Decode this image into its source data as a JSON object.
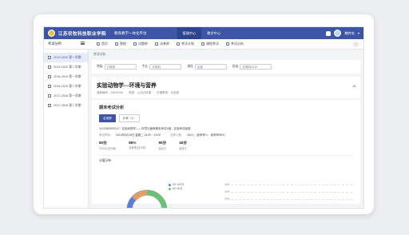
{
  "header": {
    "school_name": "江苏农牧科技职业学院",
    "platform_name": "教育教学一体化平台",
    "nav": [
      {
        "label": "管理中心",
        "active": true
      },
      {
        "label": "教学中心",
        "active": false
      }
    ],
    "user_name": "魏传东"
  },
  "secondary": {
    "section_title": "考试分析",
    "items": [
      {
        "label": "首页",
        "icon": "home-icon"
      },
      {
        "label": "院校",
        "icon": "school-icon"
      },
      {
        "label": "试题库",
        "icon": "question-bank-icon"
      },
      {
        "label": "试卷库",
        "icon": "paper-bank-icon"
      },
      {
        "label": "考试计划",
        "icon": "plan-icon"
      },
      {
        "label": "课程考试",
        "icon": "course-exam-icon"
      },
      {
        "label": "考试分析",
        "icon": "analysis-icon"
      }
    ]
  },
  "sidebar": {
    "terms": [
      {
        "label": "2019-2020 第一学期",
        "active": true
      },
      {
        "label": "2019-2020 第二学期",
        "active": false
      },
      {
        "label": "2018-2019 第一学期",
        "active": false
      },
      {
        "label": "2018-2019 第二学期",
        "active": false
      },
      {
        "label": "2017-2018 第一学期",
        "active": false
      },
      {
        "label": "2017-2018 第二学期",
        "active": false
      }
    ]
  },
  "breadcrumb": "考试分析",
  "filters": [
    {
      "label": "院级",
      "value": "计算机"
    },
    {
      "label": "专业",
      "value": "计算机"
    },
    {
      "label": "课程",
      "value": "全部"
    },
    {
      "label": "班级",
      "value": "计算机2019"
    }
  ],
  "course": {
    "title": "实验动物学---环境与营养",
    "meta": "课程编号：18030206　　类型：公共必修课　　任课教师：沈晓燕"
  },
  "analysis": {
    "title": "期末考试分析",
    "tabs": [
      {
        "label": "总成绩",
        "active": true
      },
      {
        "label": "补考（1）",
        "active": false
      }
    ],
    "exam_line": "1102180302012｜实验动物学——环境与营养期末考试A卷 - 实验考试阅卷",
    "exam_date_label": "考试时间：",
    "exam_date": "2019年6月18日 星期二 13:00 ~ 15:00",
    "attendance_label": "应考人数：",
    "attendance": "160人（参考率人，参考率98%）",
    "stats": [
      {
        "value": "80分",
        "label": "平均分(百分制)"
      },
      {
        "value": "85%",
        "label": "及格率(百分制)"
      },
      {
        "value": "90分",
        "label": "最高分"
      },
      {
        "value": "40分",
        "label": "最低分"
      }
    ],
    "distribution_title": "分值分布",
    "legend": [
      {
        "label": "90~100分",
        "color": "#5b7fd6"
      },
      {
        "label": "80~90分",
        "color": "#6cc07a"
      }
    ],
    "y_ticks": [
      "40%",
      "30%",
      "20%"
    ]
  }
}
